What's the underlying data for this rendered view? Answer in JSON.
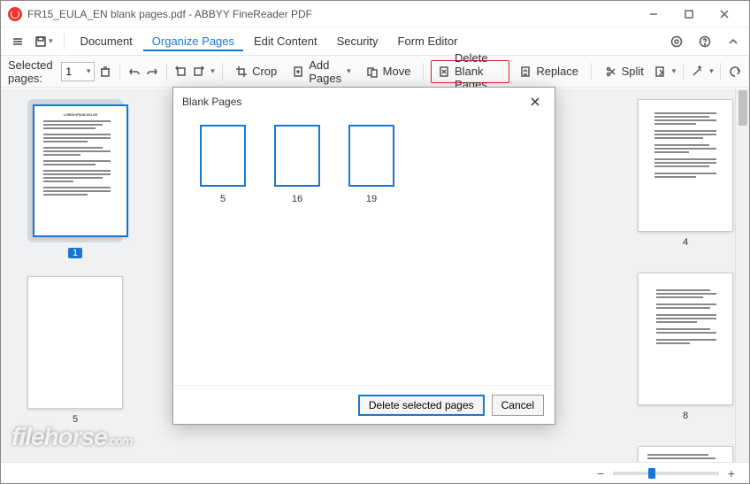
{
  "window": {
    "title": "FR15_EULA_EN blank pages.pdf - ABBYY FineReader PDF"
  },
  "menubar": {
    "document": "Document",
    "organize": "Organize Pages",
    "edit": "Edit Content",
    "security": "Security",
    "form": "Form Editor"
  },
  "toolbar": {
    "selected_pages_label": "Selected pages:",
    "selected_value": "1",
    "crop": "Crop",
    "add_pages": "Add Pages",
    "move": "Move",
    "delete_blank": "Delete Blank Pages",
    "replace": "Replace",
    "split": "Split"
  },
  "thumbs": {
    "page1": "1",
    "page4": "4",
    "page5": "5",
    "page8": "8"
  },
  "dialog": {
    "title": "Blank Pages",
    "pages": [
      "5",
      "16",
      "19"
    ],
    "primary": "Delete selected pages",
    "cancel": "Cancel"
  },
  "watermark": {
    "main": "filehorse",
    "suffix": ".com"
  }
}
